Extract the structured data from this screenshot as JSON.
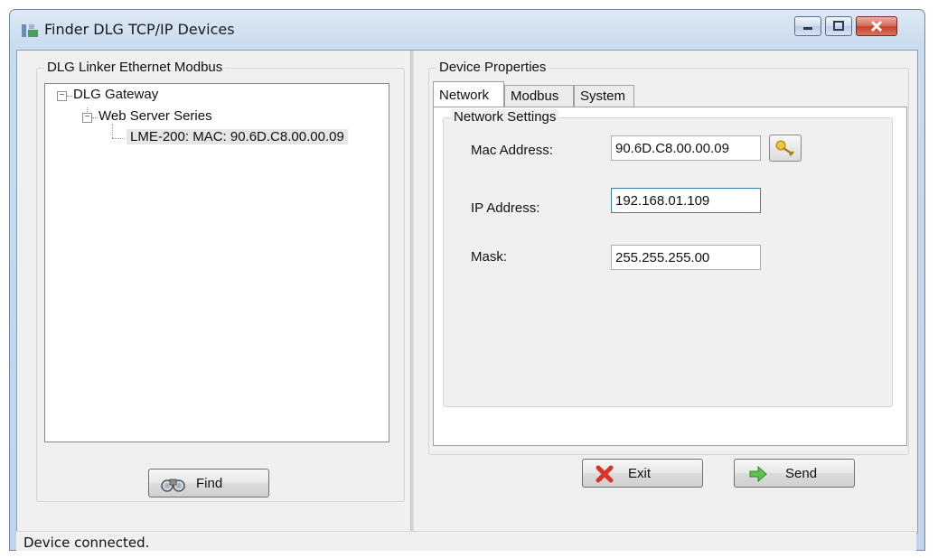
{
  "window": {
    "title": "Finder DLG TCP/IP Devices"
  },
  "left_panel": {
    "group_label": "DLG Linker Ethernet Modbus",
    "tree": [
      {
        "label": "DLG Gateway"
      },
      {
        "label": "Web Server Series"
      },
      {
        "label": "LME-200: MAC: 90.6D.C8.00.00.09"
      }
    ],
    "find_button": "Find"
  },
  "right_panel": {
    "group_label": "Device Properties",
    "tabs": [
      {
        "label": "Network"
      },
      {
        "label": "Modbus"
      },
      {
        "label": "System"
      }
    ],
    "network_settings": {
      "group_label": "Network Settings",
      "mac_label": "Mac Address:",
      "mac_value": "90.6D.C8.00.00.09",
      "ip_label": "IP Address:",
      "ip_value": "192.168.01.109",
      "mask_label": "Mask:",
      "mask_value": "255.255.255.00"
    },
    "exit_button": "Exit",
    "send_button": "Send"
  },
  "status_bar": {
    "text": "Device connected."
  },
  "icons": [
    "app-icon",
    "minimize-icon",
    "maximize-icon",
    "close-icon",
    "binoculars-icon",
    "key-icon",
    "exit-x-icon",
    "send-arrow-icon"
  ],
  "colors": {
    "close_button": "#c2402a",
    "exit_icon": "#d9332a",
    "send_icon": "#3ea83a",
    "key_icon": "#e3b51e"
  }
}
